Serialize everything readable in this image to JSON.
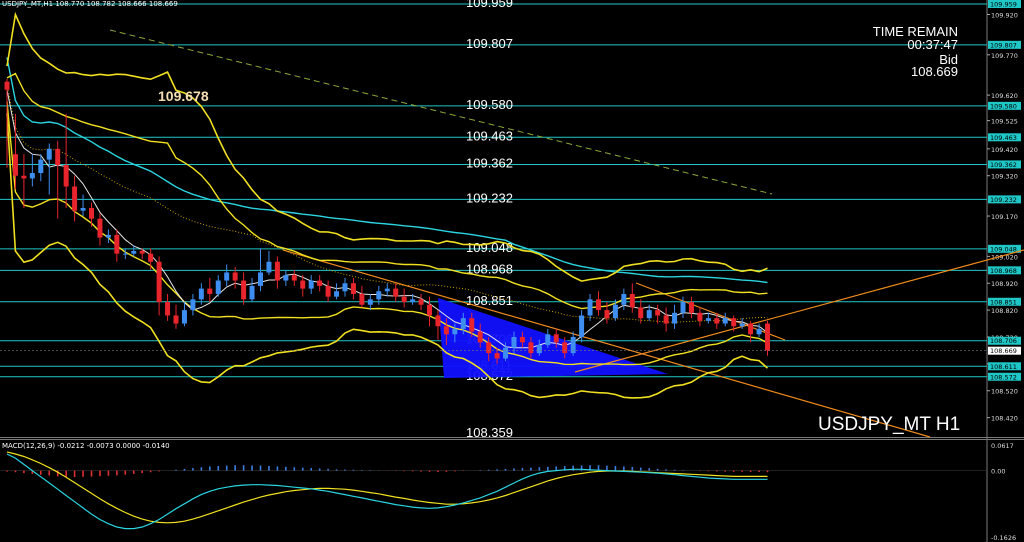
{
  "header": {
    "title": "USDJPY_MT,H1  108.770 108.782 108.666 108.669"
  },
  "timer": {
    "time_remain_label": "TIME REMAIN",
    "time_remain": "00:37:47",
    "bid_label": "Bid",
    "bid": "108.669"
  },
  "symbol_label": "USDJPY_MT  H1",
  "high_label": "109.678",
  "macd_label": "MACD(12,26,9) -0.0212 -0.0073 0.0000 -0.0140",
  "colors": {
    "background": "#000000",
    "bull": "#3d8ef0",
    "bear": "#e8242c",
    "level_line": "#1fc7c7",
    "bollinger": "#f0e020",
    "ma_cyan": "#2ad4e0",
    "ma_white": "#e6e6e6",
    "ma_dotted": "#c8a000",
    "trend_orange": "#f08a1c",
    "trend_dashed": "#8ca83c",
    "triangle": "#1010ff",
    "axis_tag": "#1fc7c7"
  },
  "chart_data": [
    {
      "type": "candlestick",
      "symbol": "USDJPY_MT",
      "timeframe": "H1",
      "ylim": [
        108.359,
        109.959
      ],
      "y_ticks": [
        "109.920",
        "109.770",
        "109.620",
        "109.525",
        "109.420",
        "109.320",
        "109.170",
        "109.020",
        "108.920",
        "108.820",
        "108.720",
        "108.620",
        "108.520",
        "108.420"
      ],
      "horizontal_levels": [
        {
          "value": "109.959",
          "tag": "109.959"
        },
        {
          "value": "109.807",
          "tag": "109.807"
        },
        {
          "value": "109.580",
          "tag": "109.580"
        },
        {
          "value": "109.463",
          "tag": "109.463"
        },
        {
          "value": "109.362",
          "tag": "109.362"
        },
        {
          "value": "109.232",
          "tag": "109.232"
        },
        {
          "value": "109.048",
          "tag": "109.048"
        },
        {
          "value": "108.968",
          "tag": "108.968"
        },
        {
          "value": "108.851",
          "tag": "108.851"
        },
        {
          "value": "108.706",
          "tag": "108.706"
        },
        {
          "value": "108.611",
          "tag": "108.611"
        },
        {
          "value": "108.572",
          "tag": "108.572"
        },
        {
          "value": "108.359",
          "tag": ""
        }
      ],
      "current_price": "108.669",
      "candles": [
        [
          109.67,
          109.64,
          109.68,
          109.35
        ],
        [
          109.4,
          109.32,
          109.55,
          109.27
        ],
        [
          109.32,
          109.31,
          109.4,
          109.2
        ],
        [
          109.31,
          109.33,
          109.4,
          109.28
        ],
        [
          109.33,
          109.38,
          109.4,
          109.3
        ],
        [
          109.38,
          109.42,
          109.44,
          109.25
        ],
        [
          109.42,
          109.36,
          109.45,
          109.16
        ],
        [
          109.36,
          109.28,
          109.55,
          109.2
        ],
        [
          109.28,
          109.19,
          109.32,
          109.15
        ],
        [
          109.19,
          109.2,
          109.25,
          109.17
        ],
        [
          109.2,
          109.16,
          109.22,
          109.13
        ],
        [
          109.16,
          109.09,
          109.18,
          109.06
        ],
        [
          109.09,
          109.1,
          109.12,
          109.07
        ],
        [
          109.1,
          109.03,
          109.12,
          109.0
        ],
        [
          109.03,
          109.03,
          109.05,
          109.01
        ],
        [
          109.03,
          109.04,
          109.06,
          109.02
        ],
        [
          109.04,
          109.03,
          109.05,
          109.01
        ],
        [
          109.03,
          109.0,
          109.05,
          108.97
        ],
        [
          109.0,
          108.85,
          109.02,
          108.8
        ],
        [
          108.85,
          108.8,
          108.88,
          108.78
        ],
        [
          108.8,
          108.77,
          108.84,
          108.75
        ],
        [
          108.77,
          108.82,
          108.85,
          108.76
        ],
        [
          108.82,
          108.86,
          108.88,
          108.8
        ],
        [
          108.86,
          108.9,
          108.92,
          108.84
        ],
        [
          108.9,
          108.88,
          108.94,
          108.85
        ],
        [
          108.88,
          108.93,
          108.95,
          108.87
        ],
        [
          108.93,
          108.96,
          108.99,
          108.91
        ],
        [
          108.96,
          108.93,
          108.98,
          108.9
        ],
        [
          108.93,
          108.86,
          108.96,
          108.84
        ],
        [
          108.86,
          108.91,
          108.94,
          108.85
        ],
        [
          108.91,
          108.96,
          109.05,
          108.89
        ],
        [
          108.96,
          109.0,
          109.04,
          108.95
        ],
        [
          109.0,
          108.93,
          109.02,
          108.9
        ],
        [
          108.93,
          108.95,
          108.97,
          108.91
        ],
        [
          108.95,
          108.93,
          108.97,
          108.91
        ],
        [
          108.93,
          108.9,
          108.95,
          108.87
        ],
        [
          108.9,
          108.93,
          108.95,
          108.88
        ],
        [
          108.93,
          108.91,
          108.95,
          108.89
        ],
        [
          108.91,
          108.87,
          108.93,
          108.85
        ],
        [
          108.87,
          108.89,
          108.92,
          108.86
        ],
        [
          108.89,
          108.92,
          108.94,
          108.87
        ],
        [
          108.92,
          108.88,
          108.94,
          108.86
        ],
        [
          108.88,
          108.84,
          108.91,
          108.83
        ],
        [
          108.84,
          108.86,
          108.88,
          108.82
        ],
        [
          108.86,
          108.89,
          108.91,
          108.84
        ],
        [
          108.89,
          108.9,
          108.92,
          108.87
        ],
        [
          108.9,
          108.87,
          108.92,
          108.85
        ],
        [
          108.87,
          108.85,
          108.9,
          108.83
        ],
        [
          108.85,
          108.86,
          108.88,
          108.84
        ],
        [
          108.86,
          108.84,
          108.88,
          108.82
        ],
        [
          108.84,
          108.8,
          108.87,
          108.76
        ],
        [
          108.8,
          108.76,
          108.82,
          108.71
        ],
        [
          108.76,
          108.73,
          108.79,
          108.69
        ],
        [
          108.73,
          108.75,
          108.77,
          108.7
        ],
        [
          108.75,
          108.79,
          108.81,
          108.73
        ],
        [
          108.79,
          108.74,
          108.81,
          108.72
        ],
        [
          108.74,
          108.7,
          108.77,
          108.68
        ],
        [
          108.7,
          108.66,
          108.72,
          108.63
        ],
        [
          108.66,
          108.64,
          108.68,
          108.62
        ],
        [
          108.64,
          108.68,
          108.7,
          108.63
        ],
        [
          108.68,
          108.72,
          108.74,
          108.66
        ],
        [
          108.72,
          108.7,
          108.74,
          108.68
        ],
        [
          108.7,
          108.66,
          108.72,
          108.64
        ],
        [
          108.66,
          108.69,
          108.71,
          108.65
        ],
        [
          108.69,
          108.73,
          108.75,
          108.68
        ],
        [
          108.73,
          108.7,
          108.75,
          108.68
        ],
        [
          108.7,
          108.66,
          108.72,
          108.64
        ],
        [
          108.66,
          108.72,
          108.74,
          108.65
        ],
        [
          108.72,
          108.8,
          108.82,
          108.7
        ],
        [
          108.8,
          108.86,
          108.88,
          108.78
        ],
        [
          108.86,
          108.82,
          108.89,
          108.8
        ],
        [
          108.82,
          108.79,
          108.85,
          108.77
        ],
        [
          108.79,
          108.84,
          108.86,
          108.78
        ],
        [
          108.84,
          108.88,
          108.9,
          108.82
        ],
        [
          108.88,
          108.83,
          108.92,
          108.81
        ],
        [
          108.83,
          108.79,
          108.86,
          108.77
        ],
        [
          108.79,
          108.82,
          108.84,
          108.78
        ],
        [
          108.82,
          108.8,
          108.84,
          108.77
        ],
        [
          108.8,
          108.77,
          108.83,
          108.74
        ],
        [
          108.77,
          108.81,
          108.84,
          108.75
        ],
        [
          108.81,
          108.85,
          108.87,
          108.79
        ],
        [
          108.85,
          108.81,
          108.87,
          108.79
        ],
        [
          108.81,
          108.78,
          108.83,
          108.76
        ],
        [
          108.78,
          108.79,
          108.81,
          108.77
        ],
        [
          108.79,
          108.77,
          108.81,
          108.75
        ],
        [
          108.77,
          108.79,
          108.81,
          108.76
        ],
        [
          108.79,
          108.76,
          108.8,
          108.74
        ],
        [
          108.76,
          108.77,
          108.79,
          108.75
        ],
        [
          108.77,
          108.73,
          108.78,
          108.7
        ],
        [
          108.73,
          108.75,
          108.77,
          108.72
        ],
        [
          108.77,
          108.67,
          108.78,
          108.65
        ]
      ]
    },
    {
      "type": "bar",
      "title": "MACD(12,26,9)",
      "y_ticks": [
        "0.0617",
        "0.00",
        "-0.1626"
      ],
      "ylim": [
        -0.1626,
        0.0617
      ],
      "values": [
        -0.005,
        -0.008,
        -0.012,
        -0.016,
        -0.02,
        -0.024,
        -0.028,
        -0.03,
        -0.031,
        -0.03,
        -0.029,
        -0.027,
        -0.025,
        -0.023,
        -0.02,
        -0.016,
        -0.012,
        -0.008,
        -0.004,
        0.0,
        0.004,
        0.008,
        0.012,
        0.016,
        0.02,
        0.022,
        0.024,
        0.026,
        0.026,
        0.025,
        0.024,
        0.022,
        0.02,
        0.018,
        0.016,
        0.014,
        0.012,
        0.01,
        0.008,
        0.006,
        0.005,
        0.004,
        0.003,
        0.002,
        0.001,
        -0.001,
        -0.002,
        -0.003,
        -0.004,
        -0.005,
        -0.006,
        -0.007,
        -0.006,
        -0.004,
        -0.002,
        0.0,
        0.002,
        0.004,
        0.006,
        0.008,
        0.01,
        0.012,
        0.014,
        0.016,
        0.018,
        0.02,
        0.022,
        0.024,
        0.025,
        0.026,
        0.026,
        0.024,
        0.022,
        0.02,
        0.017,
        0.014,
        0.011,
        0.008,
        0.006,
        0.004,
        0.002,
        0.0,
        -0.002,
        -0.003,
        -0.004,
        -0.005,
        -0.006,
        -0.006,
        -0.007,
        -0.007,
        -0.008
      ],
      "macd_line": [
        0.04,
        0.03,
        0.015,
        0.0,
        -0.015,
        -0.03,
        -0.045,
        -0.06,
        -0.075,
        -0.09,
        -0.105,
        -0.118,
        -0.128,
        -0.136,
        -0.14,
        -0.14,
        -0.136,
        -0.128,
        -0.118,
        -0.105,
        -0.092,
        -0.08,
        -0.068,
        -0.058,
        -0.05,
        -0.044,
        -0.04,
        -0.037,
        -0.035,
        -0.034,
        -0.034,
        -0.035,
        -0.036,
        -0.038,
        -0.04,
        -0.042,
        -0.044,
        -0.047,
        -0.05,
        -0.054,
        -0.058,
        -0.062,
        -0.066,
        -0.07,
        -0.074,
        -0.078,
        -0.082,
        -0.085,
        -0.088,
        -0.09,
        -0.091,
        -0.09,
        -0.087,
        -0.083,
        -0.078,
        -0.072,
        -0.066,
        -0.058,
        -0.05,
        -0.04,
        -0.03,
        -0.02,
        -0.012,
        -0.006,
        -0.002,
        0.0,
        0.002,
        0.003,
        0.003,
        0.002,
        0.001,
        0.0,
        -0.001,
        -0.002,
        -0.003,
        -0.004,
        -0.005,
        -0.006,
        -0.008,
        -0.01,
        -0.012,
        -0.014,
        -0.016,
        -0.018,
        -0.019,
        -0.02,
        -0.021,
        -0.021,
        -0.021,
        -0.021,
        -0.021
      ],
      "signal_line": [
        0.045,
        0.04,
        0.034,
        0.026,
        0.017,
        0.007,
        -0.004,
        -0.016,
        -0.029,
        -0.042,
        -0.055,
        -0.068,
        -0.08,
        -0.091,
        -0.101,
        -0.11,
        -0.117,
        -0.122,
        -0.125,
        -0.126,
        -0.125,
        -0.122,
        -0.117,
        -0.111,
        -0.104,
        -0.097,
        -0.09,
        -0.083,
        -0.076,
        -0.07,
        -0.064,
        -0.059,
        -0.055,
        -0.051,
        -0.048,
        -0.046,
        -0.044,
        -0.043,
        -0.043,
        -0.044,
        -0.045,
        -0.047,
        -0.05,
        -0.053,
        -0.056,
        -0.06,
        -0.064,
        -0.067,
        -0.071,
        -0.074,
        -0.077,
        -0.079,
        -0.081,
        -0.081,
        -0.08,
        -0.078,
        -0.075,
        -0.071,
        -0.066,
        -0.06,
        -0.053,
        -0.046,
        -0.039,
        -0.032,
        -0.025,
        -0.019,
        -0.014,
        -0.01,
        -0.007,
        -0.004,
        -0.002,
        -0.001,
        -0.001,
        -0.001,
        -0.002,
        -0.003,
        -0.004,
        -0.005,
        -0.006,
        -0.007,
        -0.008,
        -0.009,
        -0.01,
        -0.011,
        -0.012,
        -0.013,
        -0.014,
        -0.014,
        -0.014,
        -0.014,
        -0.014
      ]
    }
  ]
}
